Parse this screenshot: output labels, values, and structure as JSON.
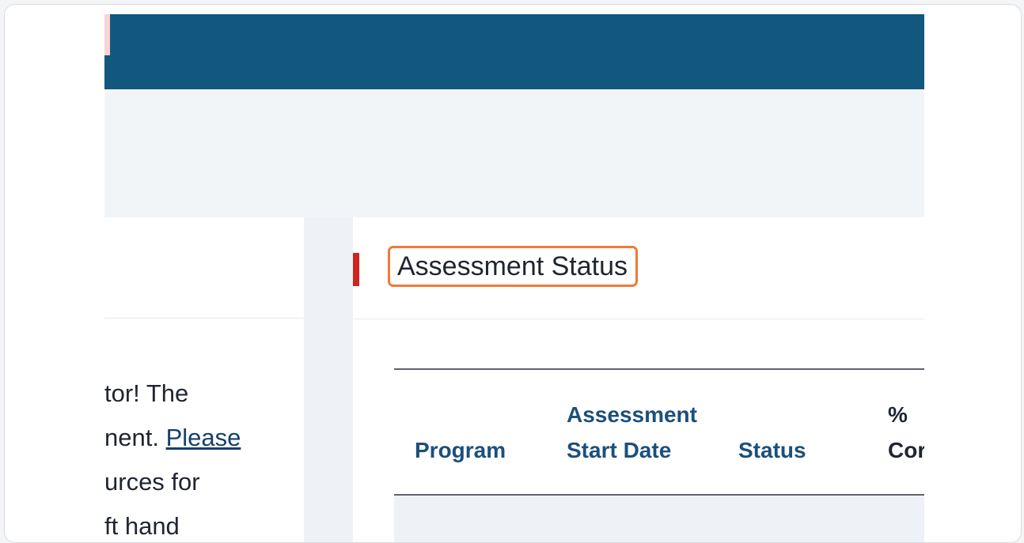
{
  "left_panel": {
    "line1": "tor! The",
    "line2_prefix": "nent. ",
    "line2_link": "Please",
    "line3": "urces for",
    "line4": "ft hand"
  },
  "assessment_panel": {
    "title": "Assessment Status",
    "table": {
      "headers": {
        "program": "Program",
        "start_date_line1": "Assessment",
        "start_date_line2": "Start Date",
        "status": "Status",
        "percent_line1": "%",
        "percent_line2": "Cor"
      }
    }
  }
}
